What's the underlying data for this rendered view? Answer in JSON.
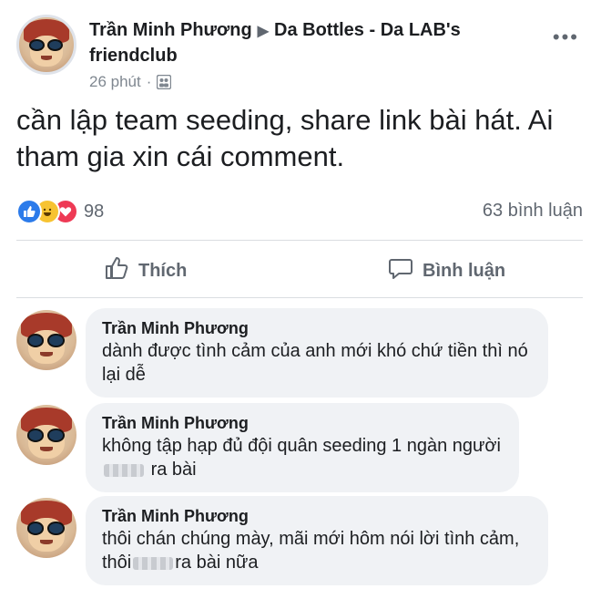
{
  "post": {
    "author": "Trần Minh Phương",
    "group": "Da Bottles - Da LAB's friendclub",
    "time": "26 phút",
    "audience_icon": "group-audience-icon",
    "text": "cần lập team seeding, share link bài hát. Ai tham gia xin cái comment."
  },
  "stats": {
    "reactions": [
      "like",
      "haha",
      "love"
    ],
    "reaction_count": "98",
    "comment_count": "63 bình luận"
  },
  "actions": {
    "like_label": "Thích",
    "comment_label": "Bình luận"
  },
  "comments": [
    {
      "author": "Trần Minh Phương",
      "text_before": "dành được tình cảm của anh mới khó chứ tiền thì nó lại dễ",
      "text_after": ""
    },
    {
      "author": "Trần Minh Phương",
      "text_before": "không tập hạp đủ đội quân seeding 1 ngàn người",
      "text_after": "ra bài"
    },
    {
      "author": "Trần Minh Phương",
      "text_before": "thôi chán chúng mày, mãi mới hôm nói lời tình cảm, thôi",
      "text_after": "ra bài nữa"
    }
  ],
  "colors": {
    "accent": "#2c7bea",
    "bubble": "#f0f2f5",
    "muted": "#606770"
  }
}
